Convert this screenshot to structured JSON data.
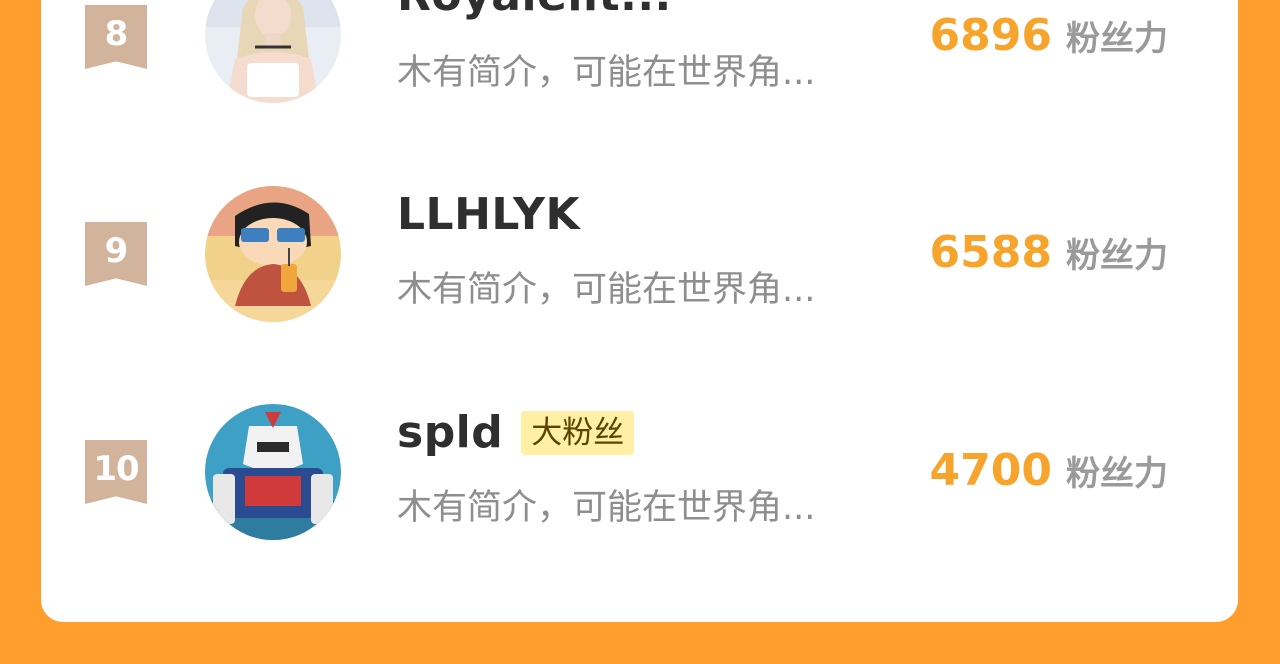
{
  "leaderboard": {
    "rows": [
      {
        "rank": "8",
        "name": "Royaleilt...",
        "badge": "",
        "bio": "木有简介，可能在世界角...",
        "score": "6896",
        "unit": "粉丝力",
        "avatar_icon": "avatar-girl-white-top-icon"
      },
      {
        "rank": "9",
        "name": "LLHLYK",
        "badge": "",
        "bio": "木有简介，可能在世界角...",
        "score": "6588",
        "unit": "粉丝力",
        "avatar_icon": "avatar-cartoon-boy-sunglasses-icon"
      },
      {
        "rank": "10",
        "name": "spld",
        "badge": "大粉丝",
        "bio": "木有简介，可能在世界角...",
        "score": "4700",
        "unit": "粉丝力",
        "avatar_icon": "avatar-robot-mech-icon"
      }
    ]
  },
  "colors": {
    "background": "#FF9E2C",
    "card": "#FFFFFF",
    "rank_flag": "#D2B49C",
    "score": "#F7A42C",
    "badge_bg": "#FFF0A6"
  }
}
